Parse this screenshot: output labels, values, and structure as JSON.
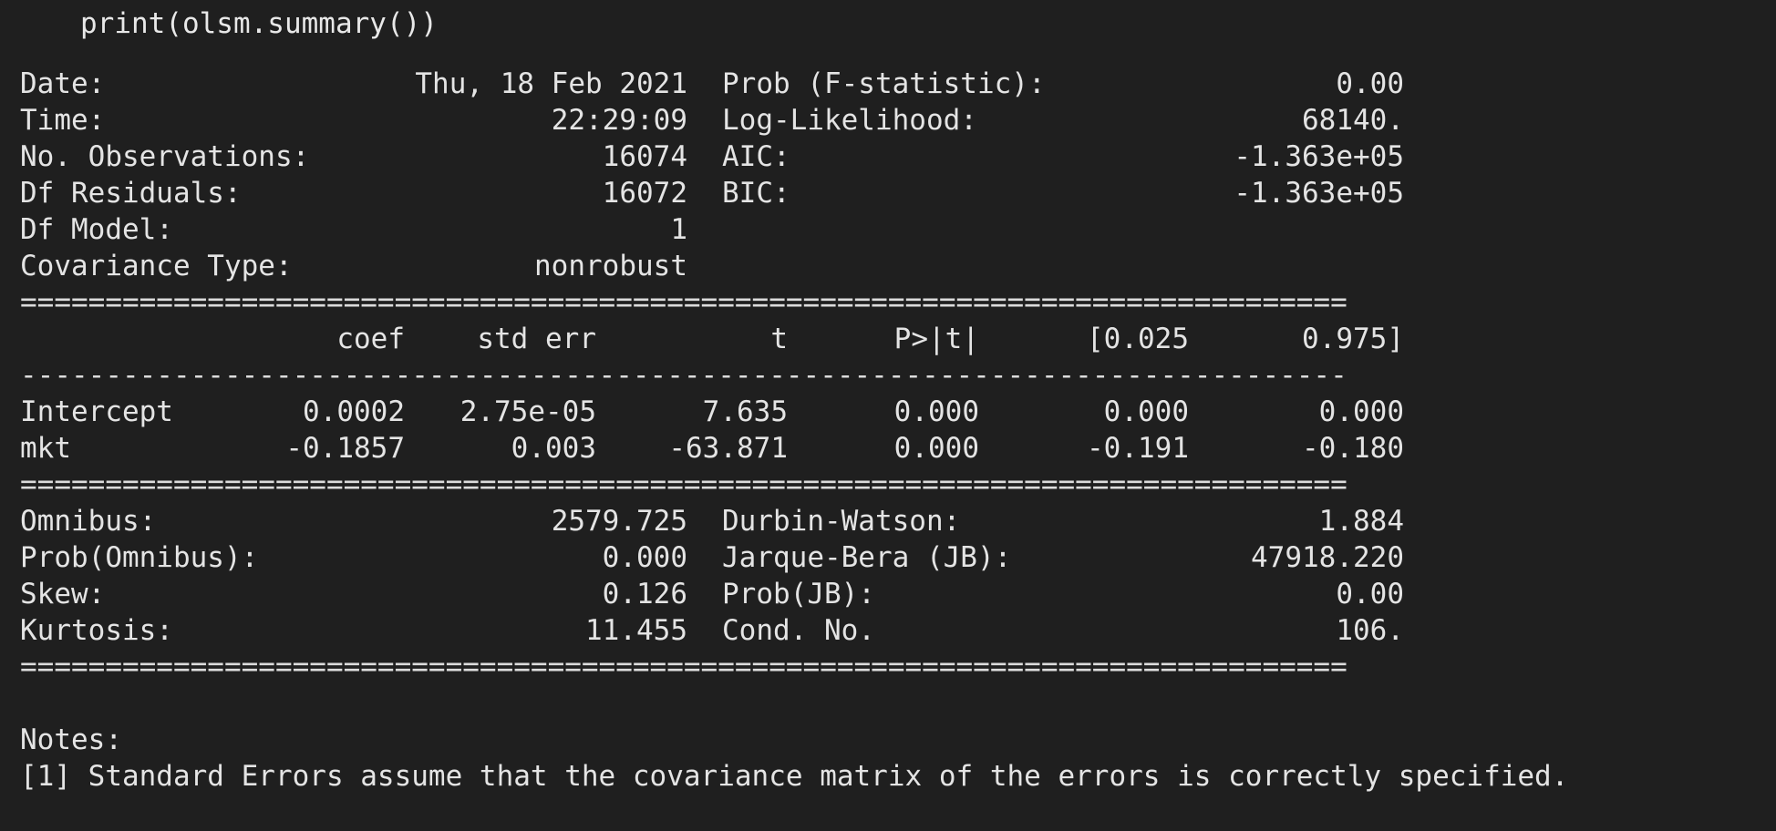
{
  "code": "print(olsm.summary())",
  "top_stats": [
    {
      "label": "Date:",
      "value": "Thu, 18 Feb 2021",
      "label2": "Prob (F-statistic):",
      "value2": "0.00"
    },
    {
      "label": "Time:",
      "value": "22:29:09",
      "label2": "Log-Likelihood:",
      "value2": "68140."
    },
    {
      "label": "No. Observations:",
      "value": "16074",
      "label2": "AIC:",
      "value2": "-1.363e+05"
    },
    {
      "label": "Df Residuals:",
      "value": "16072",
      "label2": "BIC:",
      "value2": "-1.363e+05"
    },
    {
      "label": "Df Model:",
      "value": "1",
      "label2": "",
      "value2": ""
    },
    {
      "label": "Covariance Type:",
      "value": "nonrobust",
      "label2": "",
      "value2": ""
    }
  ],
  "separator_double": "==============================================================================",
  "separator_single": "------------------------------------------------------------------------------",
  "coef_table": {
    "headers": [
      "",
      "coef",
      "std err",
      "t",
      "P>|t|",
      "[0.025",
      "0.975]"
    ],
    "rows": [
      [
        "Intercept",
        "0.0002",
        "2.75e-05",
        "7.635",
        "0.000",
        "0.000",
        "0.000"
      ],
      [
        "mkt",
        "-0.1857",
        "0.003",
        "-63.871",
        "0.000",
        "-0.191",
        "-0.180"
      ]
    ]
  },
  "bottom_stats": [
    {
      "label": "Omnibus:",
      "value": "2579.725",
      "label2": "Durbin-Watson:",
      "value2": "1.884"
    },
    {
      "label": "Prob(Omnibus):",
      "value": "0.000",
      "label2": "Jarque-Bera (JB):",
      "value2": "47918.220"
    },
    {
      "label": "Skew:",
      "value": "0.126",
      "label2": "Prob(JB):",
      "value2": "0.00"
    },
    {
      "label": "Kurtosis:",
      "value": "11.455",
      "label2": "Cond. No.",
      "value2": "106."
    }
  ],
  "notes": {
    "title": "Notes:",
    "lines": [
      "[1] Standard Errors assume that the covariance matrix of the errors is correctly specified."
    ]
  }
}
